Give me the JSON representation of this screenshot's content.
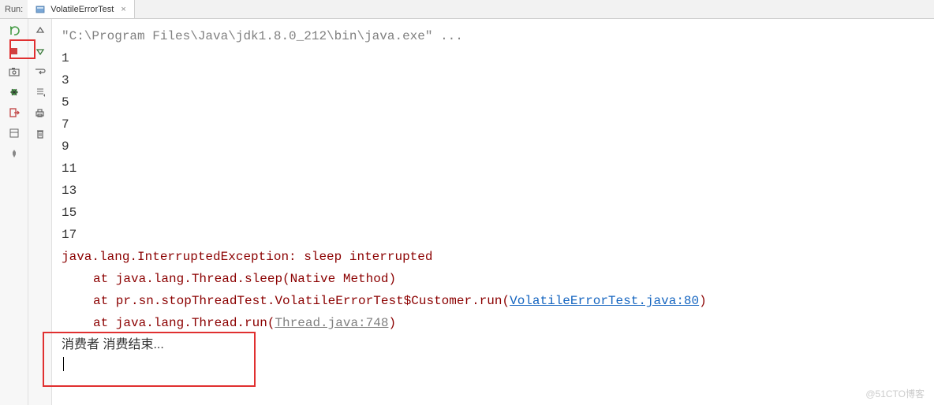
{
  "header": {
    "run_label": "Run:",
    "tab_name": "VolatileErrorTest"
  },
  "console": {
    "cmd": "\"C:\\Program Files\\Java\\jdk1.8.0_212\\bin\\java.exe\" ...",
    "numbers": [
      "1",
      "3",
      "5",
      "7",
      "9",
      "11",
      "13",
      "15",
      "17"
    ],
    "exception_head": "java.lang.InterruptedException: sleep interrupted",
    "stack1_pre": "at java.lang.Thread.sleep(Native Method)",
    "stack2_pre": "at pr.sn.stopThreadTest.VolatileErrorTest$Customer.run(",
    "stack2_link": "VolatileErrorTest.java:80",
    "stack2_post": ")",
    "stack3_pre": "at java.lang.Thread.run(",
    "stack3_link": "Thread.java:748",
    "stack3_post": ")",
    "chinese": "消费者 消费结束..."
  },
  "watermark": "@51CTO博客"
}
